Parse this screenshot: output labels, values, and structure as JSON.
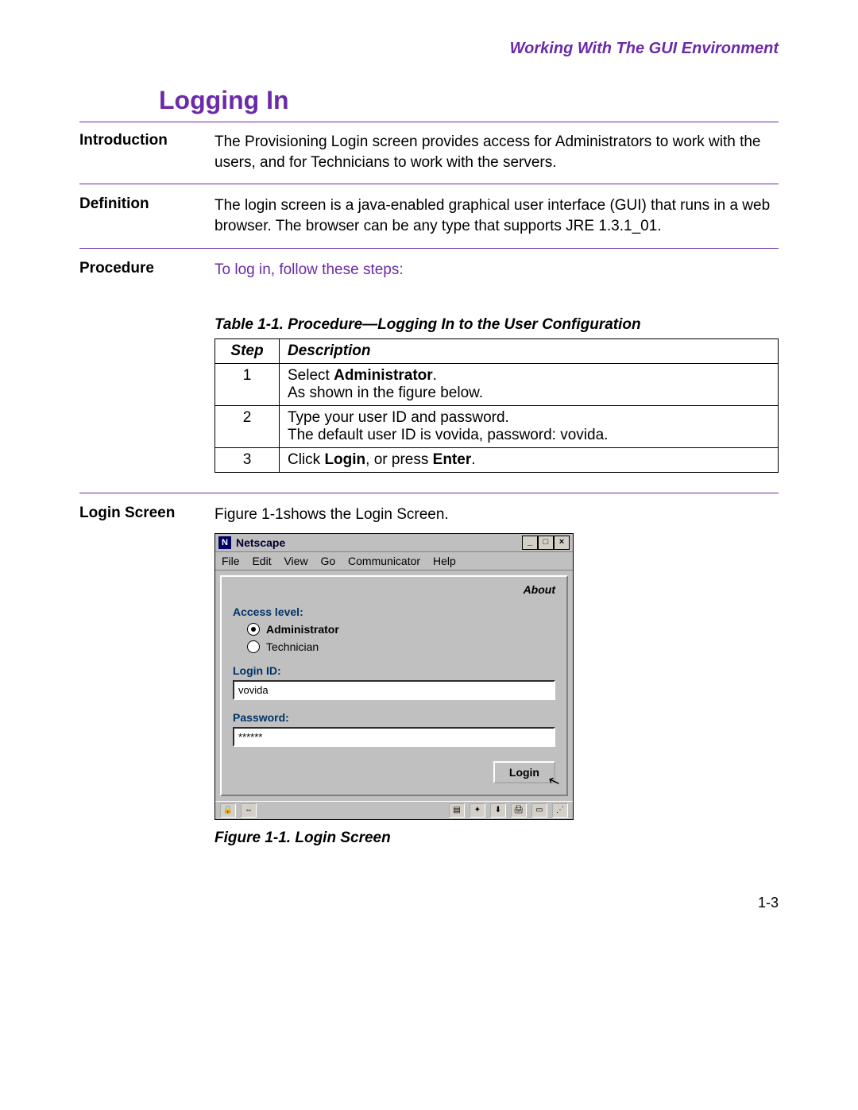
{
  "header": {
    "right": "Working With The GUI Environment"
  },
  "title": "Logging In",
  "sections": {
    "introduction": {
      "label": "Introduction",
      "text": "The Provisioning Login screen provides access for Administrators to work with the users, and for Technicians to work with the servers."
    },
    "definition": {
      "label": "Definition",
      "text": "The login screen is a java-enabled graphical user interface (GUI) that runs in a web browser. The browser can be any type that supports JRE 1.3.1_01."
    },
    "procedure": {
      "label": "Procedure",
      "text": "To log in, follow these steps:"
    },
    "login_screen": {
      "label": "Login Screen",
      "text": "Figure 1-1shows the Login Screen."
    }
  },
  "table": {
    "caption": "Table 1-1. Procedure—Logging In to the User Configuration",
    "head_step": "Step",
    "head_desc": "Description",
    "rows": [
      {
        "n": "1",
        "pre": "Select ",
        "b": "Administrator",
        "post": ".",
        "line2": "As shown in the figure below."
      },
      {
        "n": "2",
        "pre": "Type your user ID and password.",
        "b": "",
        "post": "",
        "line2": "The default user ID is vovida, password: vovida."
      },
      {
        "n": "3",
        "pre": "Click ",
        "b": "Login",
        "mid": ", or press ",
        "b2": "Enter",
        "post": "."
      }
    ]
  },
  "figure": {
    "caption": "Figure 1-1. Login Screen",
    "window_title": "Netscape",
    "menus": [
      "File",
      "Edit",
      "View",
      "Go",
      "Communicator",
      "Help"
    ],
    "about": "About",
    "access_label": "Access level:",
    "radio_admin": "Administrator",
    "radio_tech": "Technician",
    "login_id_label": "Login ID:",
    "login_id_value": "vovida",
    "password_label": "Password:",
    "password_value": "******",
    "login_button": "Login"
  },
  "footer": {
    "page": "1-3"
  }
}
